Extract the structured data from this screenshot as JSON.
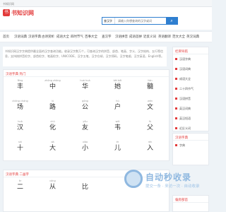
{
  "window": {
    "title": "书知识网"
  },
  "header": {
    "logo_glyph": "书",
    "logo_text": "书知识网",
    "search_scope": "查汉字",
    "search_placeholder": "请输入你想查询的汉字或词",
    "search_icon": "search-icon"
  },
  "nav": [
    "首页",
    "汉语词典",
    "汉语字典",
    "古诗赏析",
    "成语大全",
    "四时节气",
    "百事大全",
    "查汉字",
    "汉语拼音",
    "成语首拼",
    "近反义词",
    "英语翻译",
    "范文大全",
    "英汉词典"
  ],
  "notice": "书知识网汉字字典提供最全面的汉字查询功能。收录汉字数万个，可查询汉字的拼音、部首、笔画、字义、汉字结构、五行等信息，支持按拼音检字、部首检字、笔画检字、UNICODE、汉字五笔、汉字仓颉、汉字郑码、汉字笔顺、汉字英语、English等。",
  "section1": {
    "title": "汉语字典 热门",
    "rows": [
      [
        {
          "py": "fēng",
          "ch": "丰"
        },
        {
          "py": "zhōng zhòng",
          "ch": "中"
        },
        {
          "py": "huá huà",
          "ch": "华"
        },
        {
          "py": "bèi bēi",
          "ch": "她"
        },
        {
          "py": "lián",
          "ch": "髓"
        }
      ],
      [
        {
          "py": "chǎng cháng",
          "ch": "场"
        },
        {
          "py": "lú",
          "ch": "路"
        },
        {
          "py": "gōng",
          "ch": "公"
        },
        {
          "py": "hù",
          "ch": "户"
        },
        {
          "py": "wén",
          "ch": "文"
        }
      ],
      [
        {
          "py": "huò",
          "ch": "汉"
        },
        {
          "py": "chǔ",
          "ch": "化"
        },
        {
          "py": "yǒu",
          "ch": "友"
        },
        {
          "py": "wéi",
          "ch": "韦"
        },
        {
          "py": "fù",
          "ch": "父"
        }
      ],
      [
        {
          "py": "shí",
          "ch": "十"
        },
        {
          "py": "dà",
          "ch": "大"
        },
        {
          "py": "xiǎo",
          "ch": "小"
        },
        {
          "py": "ér",
          "ch": "儿"
        },
        {
          "py": "rén",
          "ch": "入"
        }
      ]
    ]
  },
  "section2": {
    "title": "汉语字典 二画字",
    "rows": [
      [
        {
          "py": "èr",
          "ch": "二"
        },
        {
          "py": "cóng",
          "ch": "从"
        },
        {
          "py": "",
          "ch": "比"
        },
        {
          "py": "",
          "ch": ""
        },
        {
          "py": "",
          "ch": ""
        }
      ]
    ]
  },
  "sidebar": {
    "title": "栏目导航",
    "items": [
      "汉语字典",
      "汉语词典",
      "成语大全",
      "二十四节气",
      "汉语拼音",
      "英汉词典",
      "英汉短语",
      "近反义词"
    ]
  },
  "sidebar2": {
    "title": "汉语字典",
    "items": [
      "字典"
    ]
  },
  "sidebar3": {
    "title": "偏旁部首"
  },
  "watermark": {
    "main": "自动秒收录",
    "sub": "提交一条 · 来访一次 · 自动收录"
  }
}
